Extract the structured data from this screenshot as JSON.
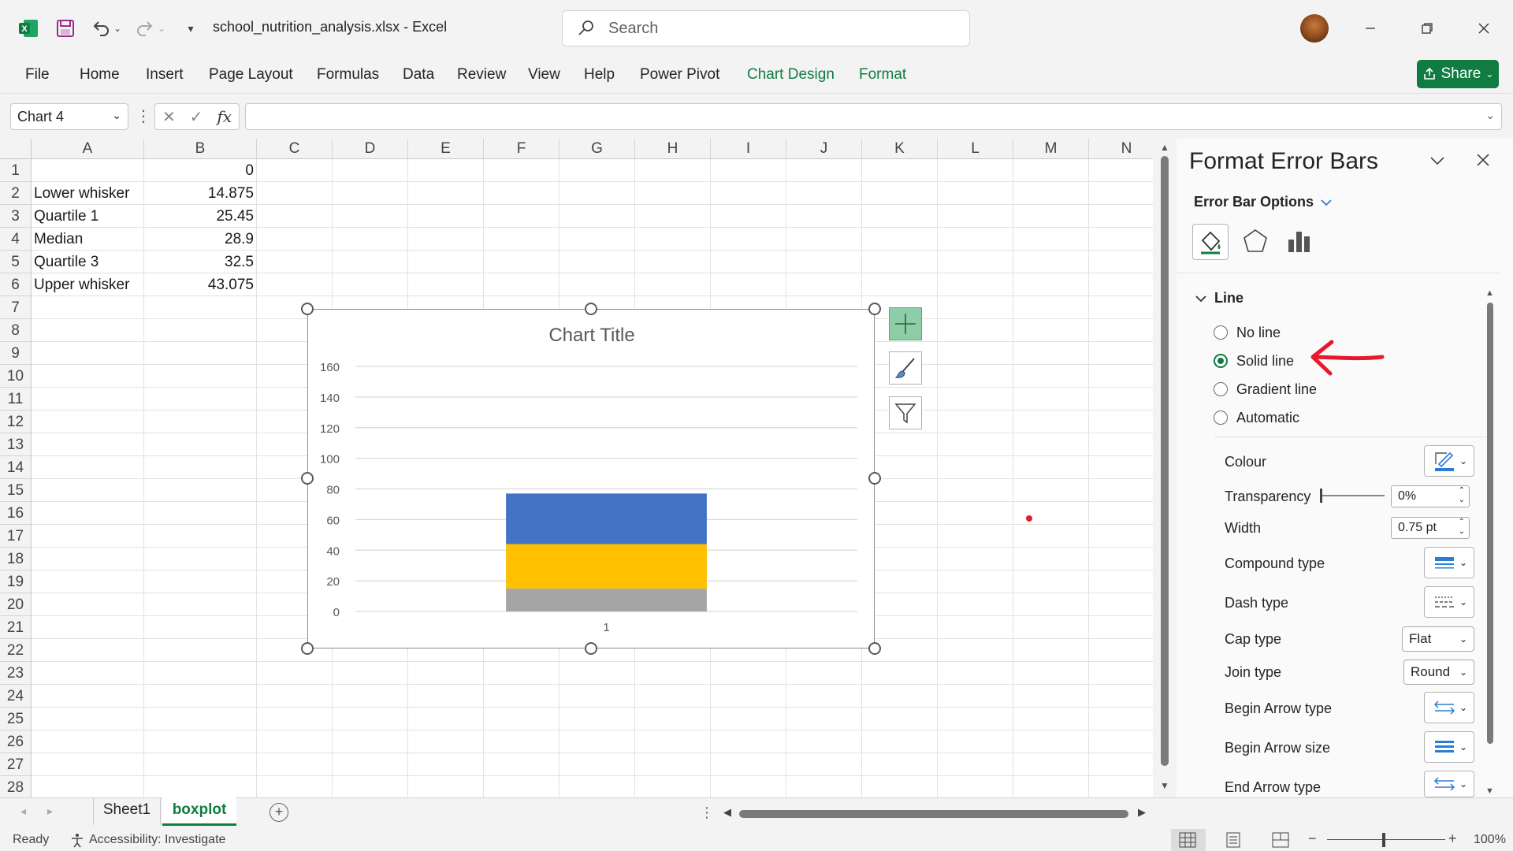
{
  "window": {
    "doc_title": "school_nutrition_analysis.xlsx  -  Excel",
    "search_placeholder": "Search"
  },
  "ribbon": {
    "tabs": [
      "File",
      "Home",
      "Insert",
      "Page Layout",
      "Formulas",
      "Data",
      "Review",
      "View",
      "Help",
      "Power Pivot",
      "Chart Design",
      "Format"
    ],
    "share_label": "Share"
  },
  "formula_bar": {
    "name_box": "Chart 4",
    "fx": "fx"
  },
  "sheet": {
    "columns": [
      "A",
      "B",
      "C",
      "D",
      "E",
      "F",
      "G",
      "H",
      "I",
      "J",
      "K",
      "L",
      "M",
      "N"
    ],
    "rows": [
      "1",
      "2",
      "3",
      "4",
      "5",
      "6",
      "7",
      "8",
      "9",
      "10",
      "11",
      "12",
      "13",
      "14",
      "15",
      "16",
      "17",
      "18",
      "19",
      "20",
      "21",
      "22",
      "23",
      "24",
      "25",
      "26",
      "27",
      "28"
    ],
    "cells": [
      {
        "a": "",
        "b": "0"
      },
      {
        "a": "Lower whisker",
        "b": "14.875"
      },
      {
        "a": "Quartile 1",
        "b": "25.45"
      },
      {
        "a": "Median",
        "b": "28.9"
      },
      {
        "a": "Quartile 3",
        "b": "32.5"
      },
      {
        "a": "Upper whisker",
        "b": "43.075"
      }
    ]
  },
  "chart_data": {
    "type": "bar",
    "title": "Chart Title",
    "categories": [
      "1"
    ],
    "stacked": true,
    "series": [
      {
        "values": [
          15
        ],
        "color": "#a5a5a5"
      },
      {
        "values": [
          29
        ],
        "color": "#ffc000"
      },
      {
        "values": [
          33
        ],
        "color": "#4472c4"
      }
    ],
    "ylim": [
      0,
      160
    ],
    "yticks": [
      "0",
      "20",
      "40",
      "60",
      "80",
      "100",
      "120",
      "140",
      "160"
    ],
    "grid": true
  },
  "sheet_tabs": {
    "tabs": [
      "Sheet1",
      "boxplot"
    ],
    "active": "boxplot"
  },
  "status": {
    "ready": "Ready",
    "accessibility": "Accessibility: Investigate",
    "zoom": "100%"
  },
  "pane": {
    "title": "Format Error Bars",
    "options_label": "Error Bar Options",
    "section": "Line",
    "radios": [
      "No line",
      "Solid line",
      "Gradient line",
      "Automatic"
    ],
    "selected": "Solid line",
    "props": {
      "colour": "Colour",
      "transparency": "Transparency",
      "transparency_value": "0%",
      "width": "Width",
      "width_value": "0.75 pt",
      "compound": "Compound type",
      "dash": "Dash type",
      "cap": "Cap type",
      "cap_value": "Flat",
      "join": "Join type",
      "join_value": "Round",
      "begin_arrow_type": "Begin Arrow type",
      "begin_arrow_size": "Begin Arrow size",
      "end_arrow_type": "End Arrow type"
    },
    "accent": "#107c41",
    "annotation_color": "#e8192c"
  }
}
